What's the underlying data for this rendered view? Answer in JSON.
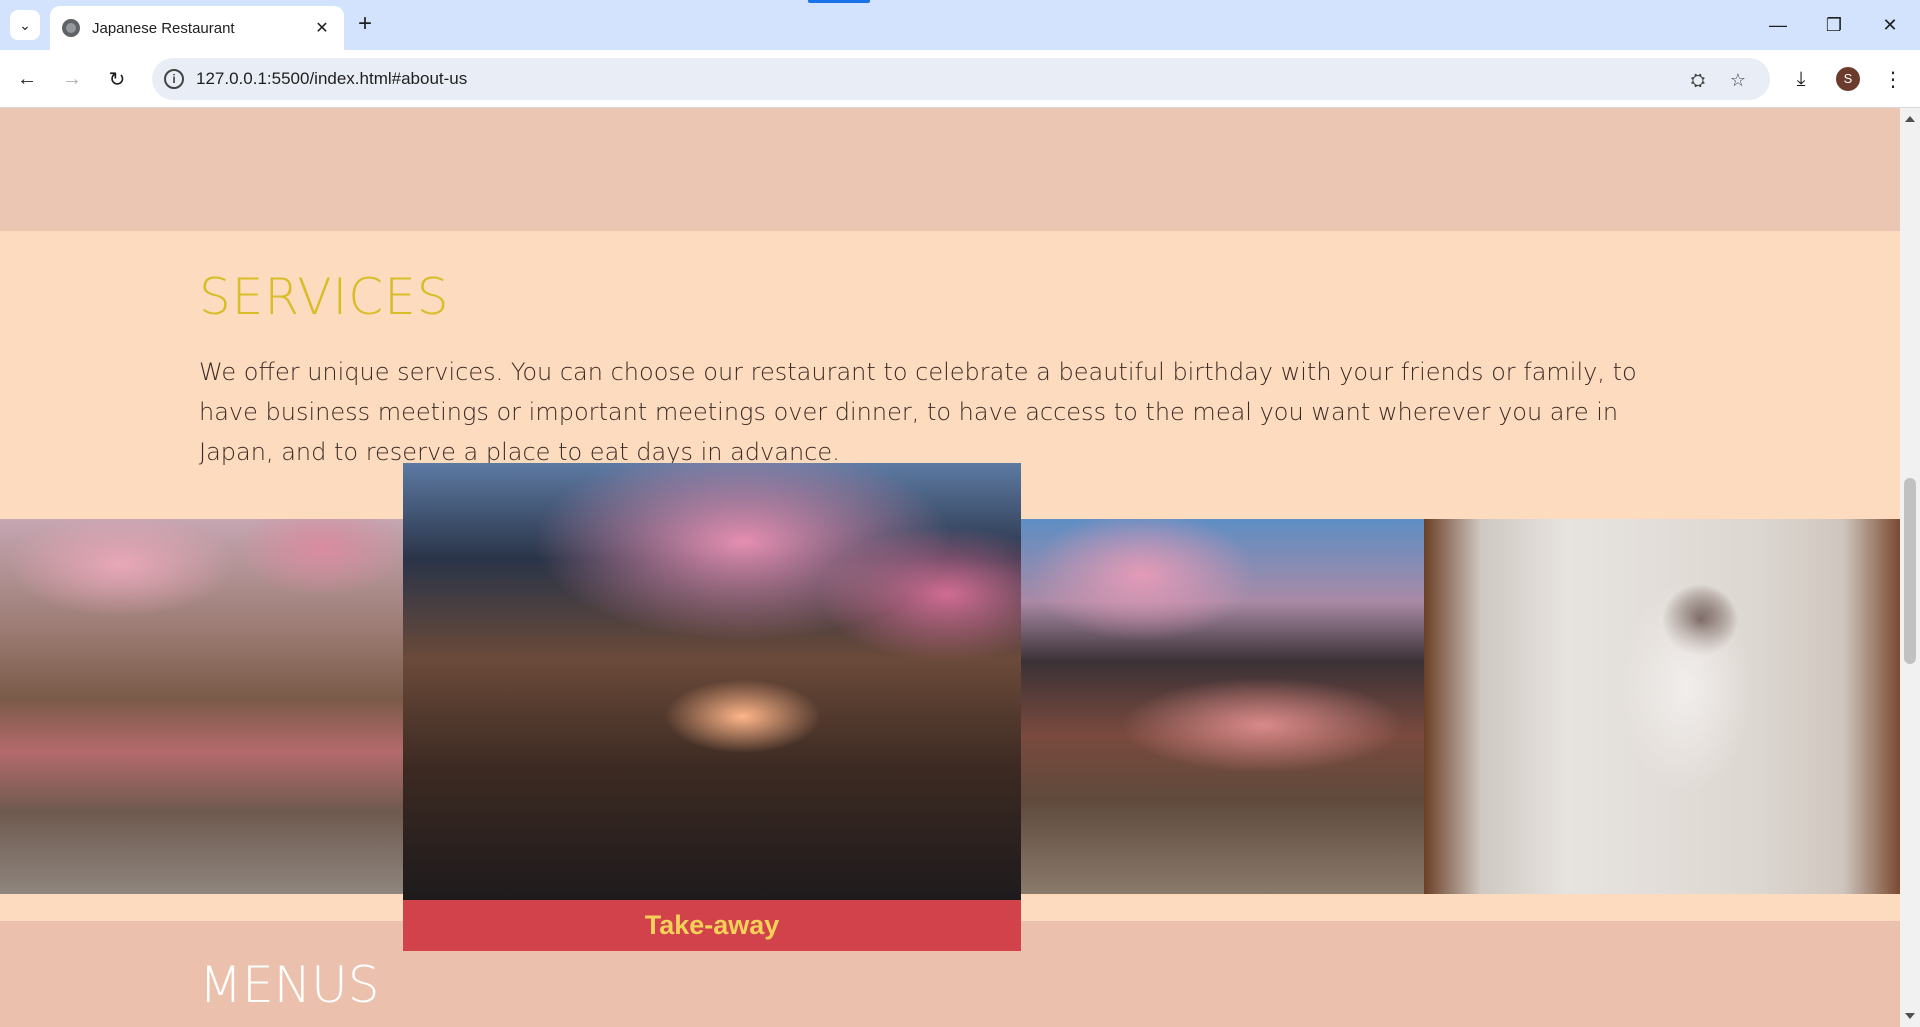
{
  "browser": {
    "tab_title": "Japanese Restaurant",
    "url": "127.0.0.1:5500/index.html#about-us",
    "profile_initial": "S"
  },
  "page": {
    "services": {
      "title": "SERVICES",
      "text": "We offer unique services. You can choose our restaurant to celebrate a beautiful birthday with your friends or family, to have business meetings or important meetings over dinner, to have access to the meal you want wherever you are in Japan, and to reserve a place to eat days in advance.",
      "gallery": [
        {
          "name": "birthday-celebration-image",
          "caption": ""
        },
        {
          "name": "take-away-image",
          "caption": "Take-away"
        },
        {
          "name": "dinner-meetings-image",
          "caption": ""
        },
        {
          "name": "reservation-image",
          "caption": ""
        }
      ]
    },
    "menus": {
      "title": "MENUS"
    }
  },
  "colors": {
    "services_title": "#d7bd27",
    "caption_bg": "#d2424b",
    "caption_text": "#f5d15a",
    "section_bg": "#fddbbf"
  }
}
